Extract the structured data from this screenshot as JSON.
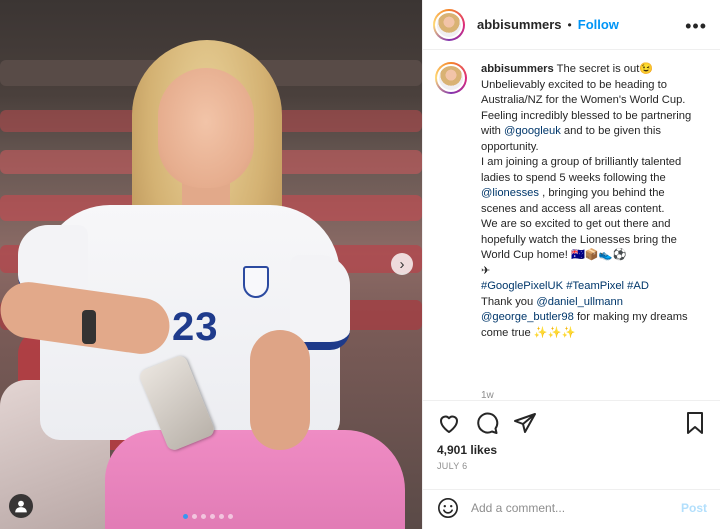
{
  "post": {
    "header": {
      "username": "abbisummers",
      "separator": "•",
      "follow_label": "Follow",
      "more_label": "•••"
    },
    "caption": {
      "username": "abbisummers",
      "line1": " The secret is out😉",
      "line2": "Unbelievably excited to be heading to Australia/NZ for the Women's World Cup.",
      "line3a": "Feeling incredibly blessed to be partnering with ",
      "mention1": "@googleuk",
      "line3b": " and to be given this opportunity.",
      "line4a": "I am joining a group of brilliantly talented ladies to spend 5 weeks following the ",
      "mention2": "@lionesses",
      "line4b": " , bringing you behind the scenes and access all areas content.",
      "line5": "We are so excited to get out there and hopefully watch the Lionesses bring the World Cup home! 🇦🇺📦👟⚽",
      "line6": "✈",
      "hashtags": "#GooglePixelUK #TeamPixel #AD",
      "line7": "Thank you ",
      "mention3": "@daniel_ullmann",
      "mention4": "@george_butler98",
      "line8": " for making my dreams come true ✨✨✨",
      "time": "1w"
    },
    "likes": "4,901 likes",
    "date": "JULY 6",
    "comment": {
      "placeholder": "Add a comment...",
      "post_label": "Post"
    },
    "photo": {
      "jersey_number": "23",
      "next_label": "›",
      "slide_count": 6,
      "active_slide": 1
    }
  },
  "colors": {
    "accent": "#0095f6",
    "link": "#00376b",
    "post_disabled": "#b2dffc",
    "pants": "#ef8cc4",
    "jersey_number": "#1f3b8c"
  },
  "icons": [
    "heart-icon",
    "comment-icon",
    "share-icon",
    "bookmark-icon",
    "emoji-icon",
    "next-arrow-icon",
    "user-tag-icon",
    "more-icon"
  ]
}
